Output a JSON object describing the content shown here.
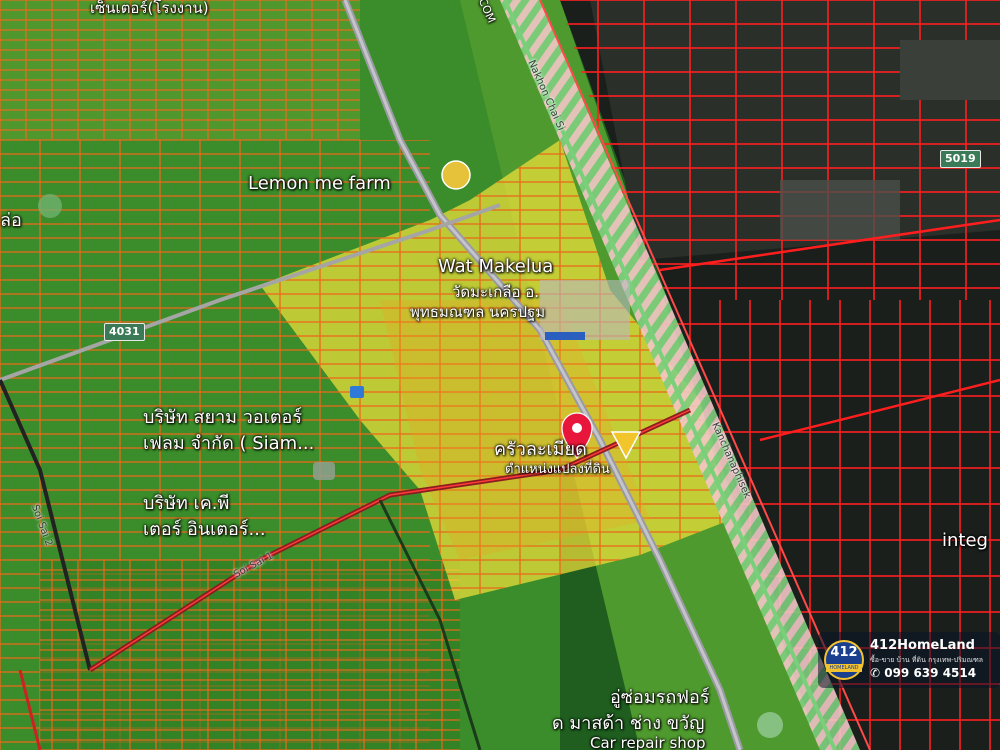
{
  "map": {
    "labels": {
      "factory_top": "เซ็นเตอร์(โรงงาน)",
      "lemon_farm": "Lemon me farm",
      "left_edge": "ล่อ",
      "wat_en": "Wat Makelua",
      "wat_th_1": "วัดมะเกลือ อ.",
      "wat_th_2": "พุทธมณฑล นครปฐม",
      "siam_1": "บริษัท สยาม วอเตอร์",
      "siam_2": "เฟลม จำกัด ( Siam...",
      "company2_1": "บริษัท เค.พี",
      "company2_2": "เตอร์ อินเตอร์...",
      "kitchen": "ครัวละเมียด",
      "repair_1": "อู่ซ่อมรถฟอร์",
      "repair_2": "ด มาสด้า ช่าง ขวัญ",
      "repair_3": "Car repair shop",
      "integ": "integ",
      "road_left": "Soi Sai 2",
      "road_bottom": "Soi Sai 1",
      "road_main": "Nakhon Chai Si",
      "road_right": "Kanchanaphisek",
      "road_top": "COM"
    },
    "shields": {
      "s4031": "4031",
      "s5019": "5019"
    },
    "marker": {
      "label": "ตำแหน่งแปลงที่ดิน",
      "color": "#e8163a"
    },
    "colors": {
      "parcel_line": "#ff2a1a",
      "highlight": "#f0e13a",
      "vegetation": "#2e7d22"
    }
  },
  "brand": {
    "logo_number": "412",
    "logo_sub": "HOMELAND",
    "name": "412HomeLand",
    "tagline": "ซื้อ-ขาย บ้าน ที่ดิน กรุงเทพ-ปริมณฑล",
    "phone": "099 639 4514"
  }
}
